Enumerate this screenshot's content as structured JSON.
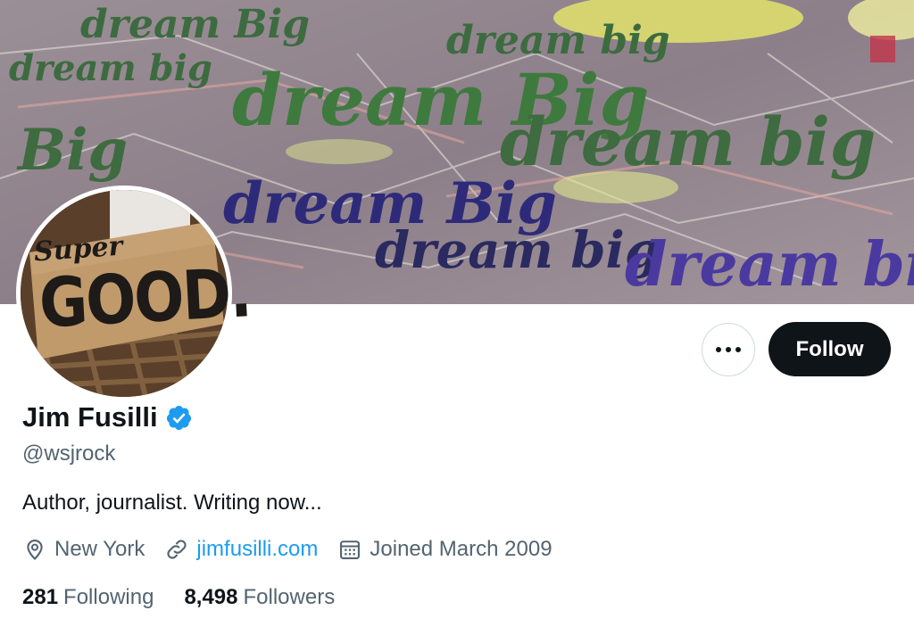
{
  "banner": {
    "scribble_words": [
      "dream Big",
      "dream big",
      "dream Big",
      "dream big",
      "Big",
      "dream big",
      "dream Big",
      "dream big",
      "dream big"
    ]
  },
  "avatar": {
    "sign_top": "Super",
    "sign_main": "GOOD."
  },
  "actions": {
    "more_icon": "more-horizontal-icon",
    "follow_label": "Follow"
  },
  "profile": {
    "name": "Jim Fusilli",
    "handle": "@wsjrock",
    "bio": "Author, journalist.  Writing now...",
    "location": "New York",
    "website": "jimfusilli.com",
    "joined": "Joined March 2009",
    "following_count": "281",
    "following_label": "Following",
    "followers_count": "8,498",
    "followers_label": "Followers"
  },
  "colors": {
    "accent": "#1d9bf0",
    "text_primary": "#0f1419",
    "text_secondary": "#536471",
    "button_dark": "#0f1419"
  }
}
